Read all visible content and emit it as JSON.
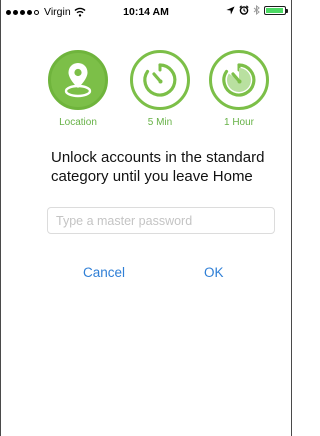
{
  "status_bar": {
    "carrier": "Virgin",
    "time": "10:14 AM",
    "signal_strength": 4,
    "signal_max": 5,
    "battery_fraction": 0.95
  },
  "options": [
    {
      "label": "Location",
      "icon": "location-pin-icon",
      "selected": true
    },
    {
      "label": "5 Min",
      "icon": "timer-icon",
      "selected": false
    },
    {
      "label": "1 Hour",
      "icon": "timer-hour-icon",
      "selected": false
    }
  ],
  "message": "Unlock accounts in the standard category until you leave Home",
  "password_field": {
    "placeholder": "Type a master password",
    "value": ""
  },
  "actions": {
    "cancel": "Cancel",
    "ok": "OK"
  },
  "colors": {
    "accent_green": "#7cbf48",
    "link_blue": "#2f7fd6",
    "battery_green": "#4cd964"
  }
}
